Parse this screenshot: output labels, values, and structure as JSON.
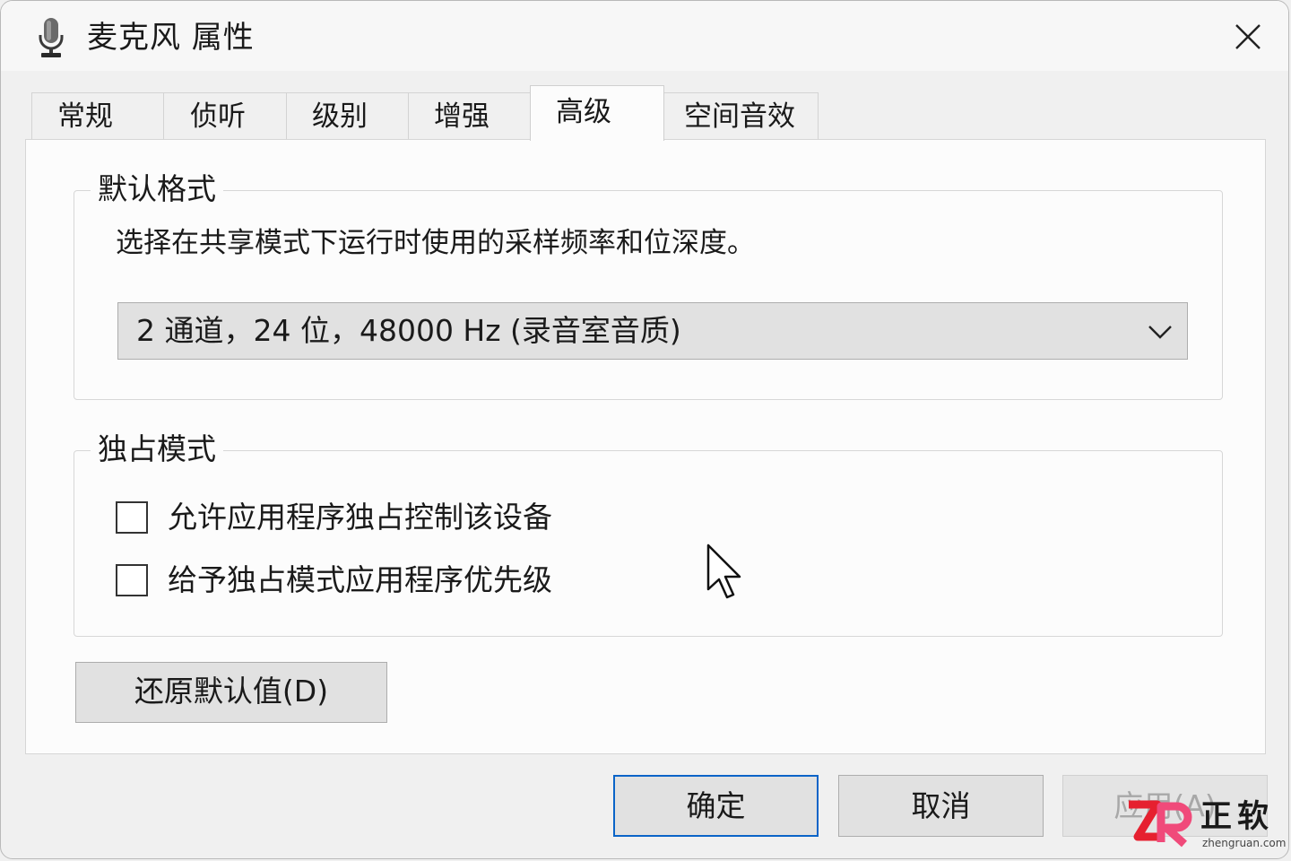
{
  "window": {
    "title": "麦克风 属性",
    "icon": "microphone-icon",
    "close_icon": "close-icon"
  },
  "tabs": [
    {
      "label": "常规",
      "active": false
    },
    {
      "label": "侦听",
      "active": false
    },
    {
      "label": "级别",
      "active": false
    },
    {
      "label": "增强",
      "active": false
    },
    {
      "label": "高级",
      "active": true
    },
    {
      "label": "空间音效",
      "active": false
    }
  ],
  "default_format": {
    "title": "默认格式",
    "description": "选择在共享模式下运行时使用的采样频率和位深度。",
    "selected_value": "2 通道，24 位，48000 Hz (录音室音质)",
    "dropdown_icon": "chevron-down-icon"
  },
  "exclusive_mode": {
    "title": "独占模式",
    "options": [
      {
        "label": "允许应用程序独占控制该设备",
        "checked": false
      },
      {
        "label": "给予独占模式应用程序优先级",
        "checked": false
      }
    ]
  },
  "restore_button": "还原默认值(D)",
  "footer": {
    "ok": "确定",
    "cancel": "取消",
    "apply": "应用(A)"
  },
  "watermark": {
    "brand": "正软",
    "url": "zhengruan.com"
  },
  "colors": {
    "default_button_border": "#0a64c8",
    "watermark_red": "#e6202f",
    "watermark_pink": "#f04a7a"
  }
}
